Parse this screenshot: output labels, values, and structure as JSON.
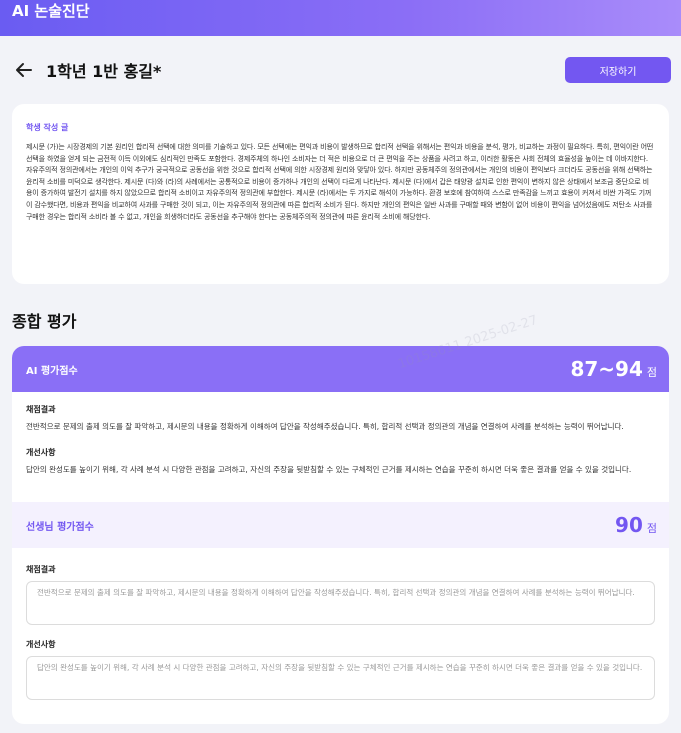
{
  "app": {
    "title": "AI 논술진단"
  },
  "header": {
    "page_title": "1학년 1반 홍길*",
    "save_label": "저장하기"
  },
  "essay": {
    "label": "학생 작성 글",
    "text": "제시문 (가)는 시장경제의 기본 원리인 합리적 선택에 대한 의미를 기술하고 있다. 모든 선택에는 편익과 비용이 발생하므로 합리적 선택을 위해서는 편익과 비용을 분석, 평가, 비교하는 과정이 필요하다. 특히, 편익이란 어떤 선택을 하였을 얻게 되는 금전적 이득 이외에도 심리적인 만족도 포함한다. 경제주체의 하나인 소비자는 더 적은 비용으로 더 큰 편익을 주는 상품을 사려고 하고, 이러한 활동은 사회 전체의 효율성을 높이는 데 이바지한다. 자유주의적 정의관에서는 개인의 이익 추구가 궁극적으로 공동선을 위한 것으로 합리적 선택에 의한 시장경제 원리와 맞닿아 있다. 하지만 공동체주의 정의관에서는 개인의 비용이 편익보다 크더라도 공동선을 위해 선택하는 윤리적 소비를 미덕으로 생각한다. 제시문 (다)와 (라)의 사례에서는 공통적으로 비용이 증가하나 개인의 선택이 다르게 나타난다. 제시문 (다)에서 갑은 태양광 설치로 인한 편익이 변하지 않은 상태에서 보조금 중단으로 비용이 증가하여 발전기 설치를 하지 않았으므로 합리적 소비이고 자유주의적 정의관에 부합한다. 제시문 (라)에서는 두 가지로 해석이 가능하다. 환경 보호에 참여하여 스스로 만족감을 느끼고 효용이 커져서 비싼 가격도 기꺼이 감수했다면, 비용과 편익을 비교하여 사과를 구매한 것이 되고, 이는 자유주의적 정의관에 따른 합리적 소비가 된다. 하지만 개인의 편익은 일반 사과를 구매할 때와 변함이 없어 비용이 편익을 넘어섰음에도 저탄소 사과를 구매한 경우는 합리적 소비라 볼 수 없고, 개인을 희생하더라도 공동선을 추구해야 한다는 공동체주의적 정의관에 따른 윤리적 소비에 해당한다."
  },
  "evaluation": {
    "section_title": "종합 평가",
    "ai": {
      "label": "AI 평가점수",
      "score": "87~94",
      "unit": "점",
      "result_label": "채점결과",
      "result_text": "전반적으로 문제의 출제 의도를 잘 파악하고, 제시문의 내용을 정확하게 이해하여 답안을 작성해주셨습니다. 특히, 합리적 선택과 정의관의 개념을 연결하여 사례를 분석하는 능력이 뛰어납니다.",
      "improve_label": "개선사항",
      "improve_text": "답안의 완성도를 높이기 위해, 각 사례 분석 시 다양한 관점을 고려하고, 자신의 주장을 뒷받침할 수 있는 구체적인 근거를 제시하는 연습을 꾸준히 하시면 더욱 좋은 결과를 얻을 수 있을 것입니다."
    },
    "teacher": {
      "label": "선생님 평가점수",
      "score": "90",
      "unit": "점",
      "result_label": "채점결과",
      "result_text": "전반적으로 문제의 출제 의도를 잘 파악하고, 제시문의 내용을 정확하게 이해하여 답안을 작성해주셨습니다. 특히, 합리적 선택과 정의관의 개념을 연결하여 사례를 분석하는 능력이 뛰어납니다.",
      "improve_label": "개선사항",
      "improve_text": "답안의 완성도를 높이기 위해, 각 사례 분석 시 다양한 관점을 고려하고, 자신의 주장을 뒷받침할 수 있는 구체적인 근거를 제시하는 연습을 꾸준히 하시면 더욱 좋은 결과를 얻을 수 있을 것입니다."
    }
  },
  "watermark": {
    "text": "10158611 2025-02-27"
  },
  "colors": {
    "accent": "#7357f1",
    "header_gradient_start": "#6a5cf2",
    "ai_head": "#8a6ff6"
  }
}
